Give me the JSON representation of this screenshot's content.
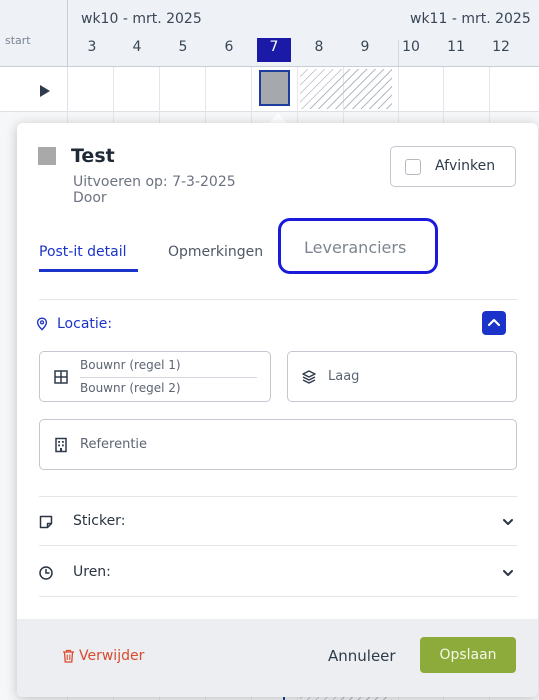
{
  "calendar": {
    "start_label": "start",
    "weeks": [
      "wk10 - mrt. 2025",
      "wk11 - mrt. 2025"
    ],
    "days": [
      "3",
      "4",
      "5",
      "6",
      "7",
      "8",
      "9",
      "10",
      "11",
      "12"
    ],
    "selected_day": "7"
  },
  "modal": {
    "title": "Test",
    "execute_on": "Uitvoeren op: 7-3-2025",
    "by": "Door",
    "check_label": "Afvinken",
    "tabs": [
      {
        "label": "Post-it detail",
        "active": true
      },
      {
        "label": "Opmerkingen",
        "active": false
      },
      {
        "label": "Leveranciers",
        "active": false,
        "highlighted": true
      }
    ],
    "location": {
      "label": "Locatie:",
      "bouwnr_1": "Bouwnr (regel 1)",
      "bouwnr_2": "Bouwnr (regel 2)",
      "laag": "Laag",
      "referentie": "Referentie"
    },
    "sections": {
      "sticker": "Sticker:",
      "uren": "Uren:"
    },
    "footer": {
      "delete": "Verwijder",
      "cancel": "Annuleer",
      "save": "Opslaan"
    }
  },
  "colors": {
    "accent": "#1a33c8",
    "selected_day_bg": "#1a1aa6",
    "save_button": "#8cab3b",
    "delete_text": "#d94a2e",
    "highlight_border": "#1a1adb"
  },
  "icons": [
    "play-icon",
    "location-pin-icon",
    "chevron-up-icon",
    "grid-icon",
    "layers-icon",
    "building-icon",
    "sticker-icon",
    "clock-icon",
    "chevron-down-icon",
    "trash-icon"
  ]
}
